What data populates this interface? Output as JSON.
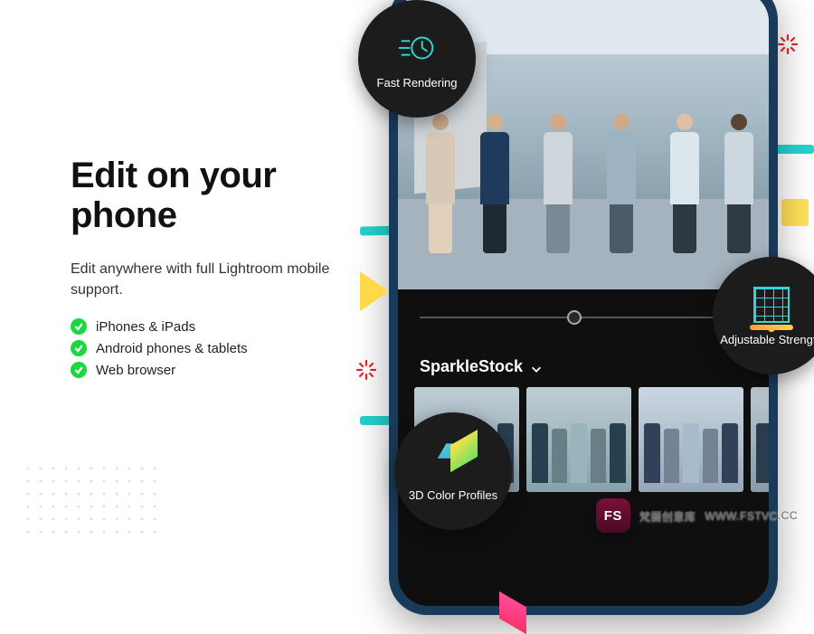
{
  "headline": "Edit on your phone",
  "subhead": "Edit anywhere with full Lightroom mobile support.",
  "features": [
    "iPhones & iPads",
    "Android phones & tablets",
    "Web browser"
  ],
  "phone": {
    "preset_group_label": "SparkleStock"
  },
  "badges": {
    "fast": "Fast Rendering",
    "adjustable": "Adjustable Strength",
    "color3d": "3D Color Profiles"
  },
  "watermark": {
    "badge_top": "FS",
    "badge_bottom": "梵摄创意库",
    "url": "WWW.FSTVC.CC"
  }
}
